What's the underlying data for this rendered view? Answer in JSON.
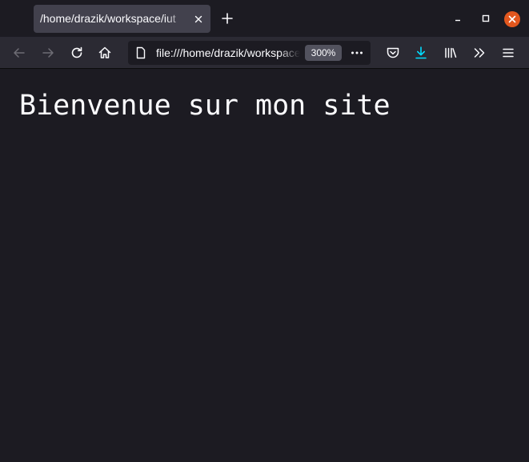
{
  "tab": {
    "title": "/home/drazik/workspace/iut"
  },
  "urlbar": {
    "url": "file:///home/drazik/workspace/iut",
    "zoom": "300%"
  },
  "page": {
    "heading": "Bienvenue sur mon site"
  },
  "icons": {
    "tab_close": "close-icon",
    "new_tab": "plus-icon",
    "back": "back-arrow-icon",
    "forward": "forward-arrow-icon",
    "reload": "reload-icon",
    "home": "home-icon",
    "page": "page-icon",
    "page_actions": "ellipsis-icon",
    "pocket": "pocket-icon",
    "downloads": "download-icon",
    "library": "library-icon",
    "overflow": "chevron-double-right-icon",
    "menu": "hamburger-menu-icon",
    "minimize": "minimize-icon",
    "maximize": "maximize-icon",
    "close_window": "close-window-icon"
  },
  "colors": {
    "background": "#1c1b22",
    "toolbar": "#2b2a33",
    "tab_selected": "#42414d",
    "text": "#fbfbfe",
    "download_accent": "#00ddff",
    "window_close": "#e2571e"
  }
}
